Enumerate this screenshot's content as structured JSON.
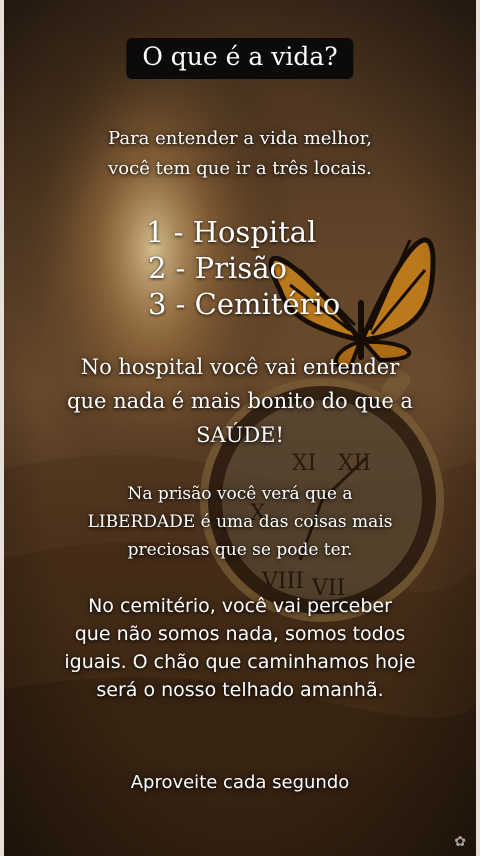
{
  "title": "O que é a vida?",
  "intro": [
    "Para entender a vida melhor,",
    "você tem que ir a três locais."
  ],
  "list": [
    "1 - Hospital",
    "2 - Prisão",
    "3 - Cemitério"
  ],
  "hospital_text": [
    "No hospital você vai entender",
    "que nada é mais bonito do que a",
    "SAÚDE!"
  ],
  "prison_text": [
    "Na prisão você verá que a",
    "LIBERDADE é uma das coisas mais",
    "preciosas que se pode ter."
  ],
  "cemetery_text": [
    "No cemitério, você vai perceber",
    "que não somos nada, somos todos",
    "iguais. O chão que caminhamos hoje",
    "será o nosso telhado amanhã."
  ],
  "footer": "Aproveite cada segundo",
  "colors": {
    "title_bg": "#0b0b0b",
    "text": "#ffffff",
    "wing": "#d58a1f"
  }
}
